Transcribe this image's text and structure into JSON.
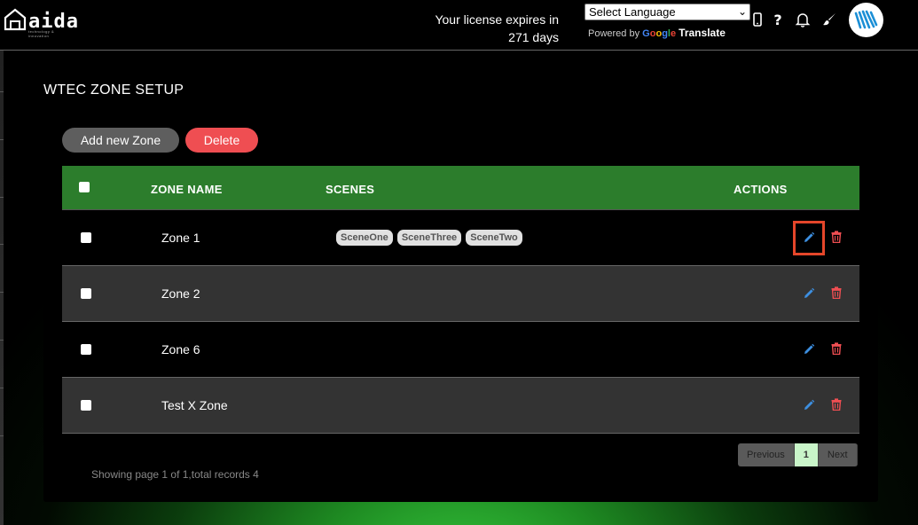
{
  "header": {
    "logo_text": "aida",
    "logo_subtext": "technology & innovation",
    "license_line1": "Your license expires in",
    "license_line2": "271 days",
    "language_select": "Select Language",
    "powered_by": "Powered by",
    "translate_label": "Translate",
    "icons": [
      "mobile-icon",
      "help-icon",
      "bell-icon",
      "brush-icon",
      "avatar-logo"
    ]
  },
  "page": {
    "title": "WTEC ZONE SETUP",
    "add_button": "Add new Zone",
    "delete_button": "Delete"
  },
  "table": {
    "columns": [
      "ZONE NAME",
      "SCENES",
      "ACTIONS"
    ],
    "rows": [
      {
        "name": "Zone 1",
        "scenes": [
          "SceneOne",
          "SceneThree",
          "SceneTwo"
        ]
      },
      {
        "name": "Zone 2",
        "scenes": []
      },
      {
        "name": "Zone 6",
        "scenes": []
      },
      {
        "name": "Test X Zone",
        "scenes": []
      }
    ]
  },
  "footer": {
    "summary": "Showing page 1 of 1,total records 4",
    "pager": {
      "previous": "Previous",
      "current": "1",
      "next": "Next"
    }
  },
  "colors": {
    "header_green": "#2c7d2c",
    "delete_red": "#ef4e52",
    "edit_blue": "#3d8fe0",
    "highlight": "#e5462a"
  }
}
